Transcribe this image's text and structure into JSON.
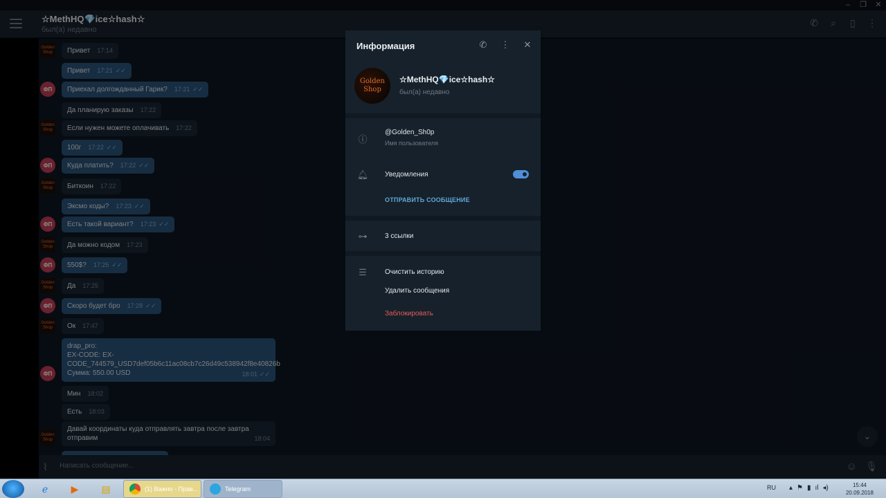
{
  "chat": {
    "title": "☆MethHQ💎ice☆hash☆",
    "status": "был(а) недавно",
    "composer_placeholder": "Написать сообщение...",
    "avatar_initials": "ФП",
    "avatar_label_top": "Golden",
    "avatar_label_bottom": "Shop",
    "messages": [
      {
        "text": "Привет",
        "time": "17:14",
        "out": false
      },
      {
        "text": "Привет",
        "time": "17:21",
        "out": true
      },
      {
        "text": "Приехал долгожданный Гарик?",
        "time": "17:21",
        "out": true
      },
      {
        "text": "Да планирую заказы",
        "time": "17:22",
        "out": false
      },
      {
        "text": "Если нужен можете оплачивать",
        "time": "17:22",
        "out": false
      },
      {
        "text": "100г",
        "time": "17:22",
        "out": true
      },
      {
        "text": "Куда платить?",
        "time": "17:22",
        "out": true
      },
      {
        "text": "Биткоин",
        "time": "17:22",
        "out": false
      },
      {
        "text": "Эксмо коды?",
        "time": "17:23",
        "out": true
      },
      {
        "text": "Есть такой вариант?",
        "time": "17:23",
        "out": true
      },
      {
        "text": "Да можно кодом",
        "time": "17:23",
        "out": false
      },
      {
        "text": "550$?",
        "time": "17:25",
        "out": true
      },
      {
        "text": "Да",
        "time": "17:25",
        "out": false
      },
      {
        "text": "Скоро будет бро",
        "time": "17:28",
        "out": true
      },
      {
        "text": "Ок",
        "time": "17:47",
        "out": false
      },
      {
        "line1": "drap_pro:",
        "line2": "EX-CODE: EX-",
        "line3": "CODE_744579_USD7def05b6c11ac08cb7c26d49c538942f8e40826b",
        "line4": "Сумма: 550.00 USD",
        "time": "18:01",
        "out": true
      },
      {
        "text": "Мин",
        "time": "18:02",
        "out": false
      },
      {
        "text": "Есть",
        "time": "18:03",
        "out": false
      },
      {
        "line1": "Давай координаты куда отправлять завтра после завтра",
        "line2": "отправим",
        "time": "18:04",
        "out": false
      }
    ]
  },
  "info": {
    "title": "Информация",
    "name": "☆MethHQ💎ice☆hash☆",
    "status": "был(а) недавно",
    "avatar_top": "Golden",
    "avatar_bottom": "Shop",
    "username": "@Golden_Sh0p",
    "username_label": "Имя пользователя",
    "notifications_label": "Уведомления",
    "notifications_on": true,
    "send_message": "ОТПРАВИТЬ СООБЩЕНИЕ",
    "links": "3 ссылки",
    "clear_history": "Очистить историю",
    "delete_messages": "Удалить сообщения",
    "block": "Заблокировать"
  },
  "taskbar": {
    "chrome_label": "(1) Важно - Прав...",
    "telegram_label": "Telegram",
    "lang": "RU",
    "time": "15:44",
    "date": "20.09.2018"
  },
  "colors": {
    "bg": "#0e1621",
    "panel": "#17212b",
    "outgoing": "#2b5278",
    "incoming": "#182533",
    "accent": "#5fa8d8",
    "danger": "#e35b5b"
  }
}
